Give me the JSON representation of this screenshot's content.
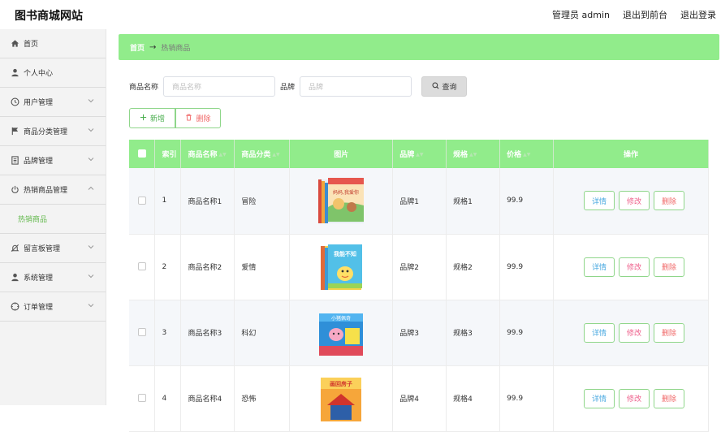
{
  "header": {
    "title": "图书商城网站",
    "admin": "管理员 admin",
    "back_front": "退出到前台",
    "logout": "退出登录"
  },
  "sidebar": {
    "items": [
      {
        "label": "首页",
        "icon": "home-icon"
      },
      {
        "label": "个人中心",
        "icon": "user-icon"
      },
      {
        "label": "用户管理",
        "icon": "clock-icon"
      },
      {
        "label": "商品分类管理",
        "icon": "flag-icon"
      },
      {
        "label": "品牌管理",
        "icon": "document-icon"
      },
      {
        "label": "热销商品管理",
        "icon": "power-icon"
      },
      {
        "label": "热销商品",
        "sub": true
      },
      {
        "label": "留言板管理",
        "icon": "bell-off-icon"
      },
      {
        "label": "系统管理",
        "icon": "user-icon"
      },
      {
        "label": "订单管理",
        "icon": "compass-icon"
      }
    ]
  },
  "breadcrumb": {
    "home": "首页",
    "arrow": "→",
    "current": "热销商品"
  },
  "search": {
    "name_label": "商品名称",
    "name_placeholder": "商品名称",
    "brand_label": "品牌",
    "brand_placeholder": "品牌",
    "query_label": "查询"
  },
  "actions": {
    "add_label": "新增",
    "delete_label": "删除"
  },
  "table": {
    "columns": [
      "索引",
      "商品名称",
      "商品分类",
      "图片",
      "品牌",
      "规格",
      "价格",
      "操作"
    ],
    "rows": [
      {
        "index": "1",
        "name": "商品名称1",
        "category": "冒险",
        "brand": "品牌1",
        "spec": "规格1",
        "price": "99.9",
        "cover_text": "妈妈,我爱你"
      },
      {
        "index": "2",
        "name": "商品名称2",
        "category": "爱情",
        "brand": "品牌2",
        "spec": "规格2",
        "price": "99.9",
        "cover_text": "我能不知"
      },
      {
        "index": "3",
        "name": "商品名称3",
        "category": "科幻",
        "brand": "品牌3",
        "spec": "规格3",
        "price": "99.9",
        "cover_text": "小猪佩奇"
      },
      {
        "index": "4",
        "name": "商品名称4",
        "category": "恐怖",
        "brand": "品牌4",
        "spec": "规格4",
        "price": "99.9",
        "cover_text": "画回房子"
      }
    ],
    "op_detail": "详情",
    "op_edit": "修改",
    "op_delete": "删除"
  },
  "colors": {
    "accent": "#91ec8b",
    "sidebar_bg": "#f3f3f3",
    "active_sub": "#63b94d"
  }
}
